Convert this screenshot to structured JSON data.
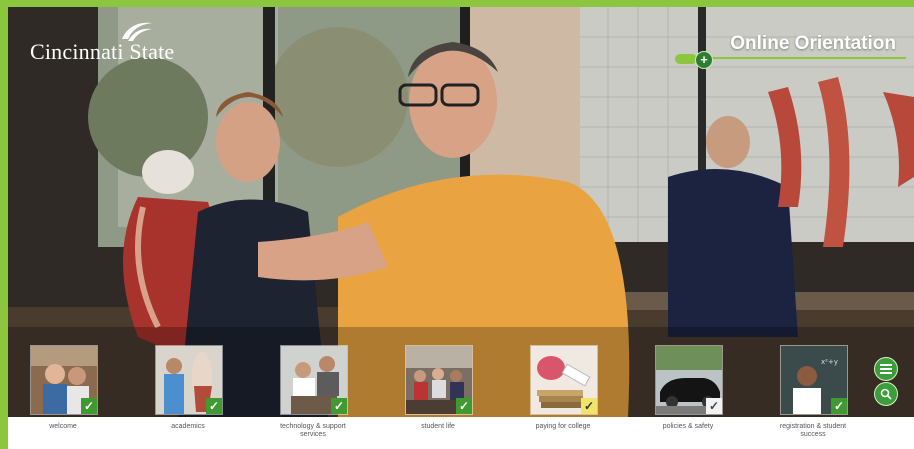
{
  "header": {
    "logo_text": "Cincinnati State",
    "title": "Online Orientation"
  },
  "modules": [
    {
      "label": "welcome",
      "status": "complete",
      "check_color": "#3f9b2f"
    },
    {
      "label": "academics",
      "status": "complete",
      "check_color": "#3f9b2f"
    },
    {
      "label": "technology & support services",
      "status": "complete",
      "check_color": "#3f9b2f"
    },
    {
      "label": "student life",
      "status": "complete",
      "check_color": "#3f9b2f"
    },
    {
      "label": "paying for college",
      "status": "in-progress",
      "check_color": "#f1e46b"
    },
    {
      "label": "policies & safety",
      "status": "visited",
      "check_color": "#f2f2f2"
    },
    {
      "label": "registration & student success",
      "status": "complete",
      "check_color": "#3f9b2f"
    }
  ],
  "side_buttons": [
    {
      "icon": "menu-icon"
    },
    {
      "icon": "search-icon"
    }
  ],
  "colors": {
    "accent_green": "#8cc63f",
    "button_green": "#3b9e3b"
  }
}
